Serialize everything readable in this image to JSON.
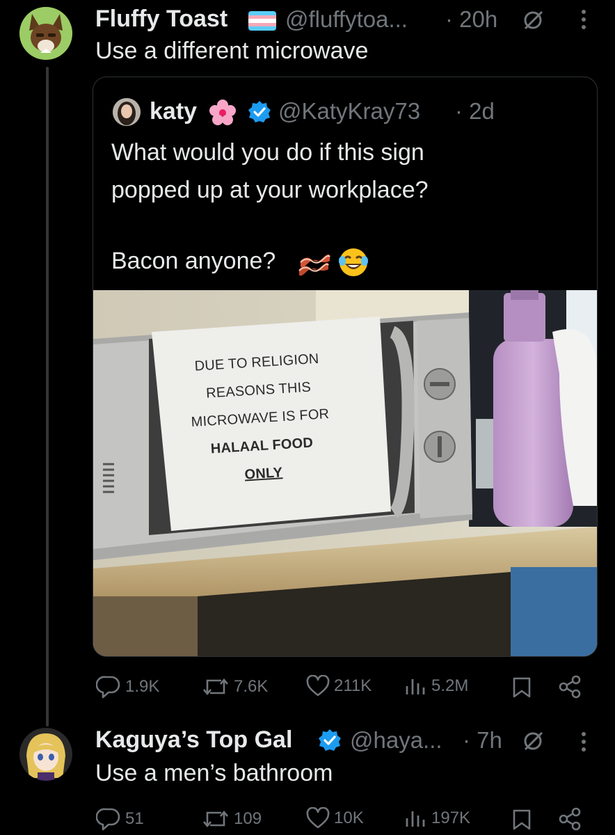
{
  "tweet1": {
    "display_name": "Fluffy Toast",
    "handle": "@fluffytoa...",
    "time": "· 20h",
    "text": "Use a different microwave"
  },
  "quote": {
    "display_name": "katy",
    "handle": "@KatyKray73",
    "time": "· 2d",
    "text_line1": "What would you do if this sign",
    "text_line2": "popped up at your workplace?",
    "text_line3": "Bacon anyone?",
    "photo_sign": {
      "line1": "DUE TO RELIGION",
      "line2": "REASONS THIS",
      "line3": "MICROWAVE IS FOR",
      "line4": "HALAAL FOOD",
      "line5": "ONLY"
    }
  },
  "tweet1_actions": {
    "replies": "1.9K",
    "reposts": "7.6K",
    "likes": "211K",
    "views": "5.2M"
  },
  "tweet2": {
    "display_name": "Kaguya’s Top Gal",
    "handle": "@haya...",
    "time": "· 7h",
    "text": "Use a men’s bathroom"
  },
  "tweet2_actions": {
    "replies": "51",
    "reposts": "109",
    "likes": "10K",
    "views": "197K"
  },
  "colors": {
    "background": "#000000",
    "text_primary": "#e7e9ea",
    "text_secondary": "#71767b",
    "verified": "#1d9bf0",
    "border": "#2f3336"
  }
}
